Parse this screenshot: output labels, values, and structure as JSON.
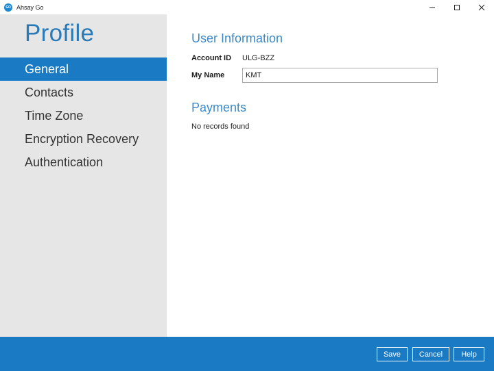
{
  "window": {
    "title": "Ahsay Go",
    "icon": "go-logo-icon",
    "controls": [
      "minimize-icon",
      "maximize-icon",
      "close-icon"
    ]
  },
  "sidebar": {
    "title": "Profile",
    "items": [
      {
        "label": "General",
        "active": true
      },
      {
        "label": "Contacts",
        "active": false
      },
      {
        "label": "Time Zone",
        "active": false
      },
      {
        "label": "Encryption Recovery",
        "active": false
      },
      {
        "label": "Authentication",
        "active": false
      }
    ]
  },
  "user_info": {
    "heading": "User Information",
    "account_id_label": "Account ID",
    "account_id_value": "ULG-BZZ",
    "name_label": "My Name",
    "name_value": "KMT"
  },
  "payments": {
    "heading": "Payments",
    "empty_message": "No records found"
  },
  "footer": {
    "save_label": "Save",
    "cancel_label": "Cancel",
    "help_label": "Help"
  },
  "colors": {
    "accent": "#1a7ac4",
    "heading": "#3b8ac6",
    "sidebar_bg": "#e6e6e6"
  }
}
